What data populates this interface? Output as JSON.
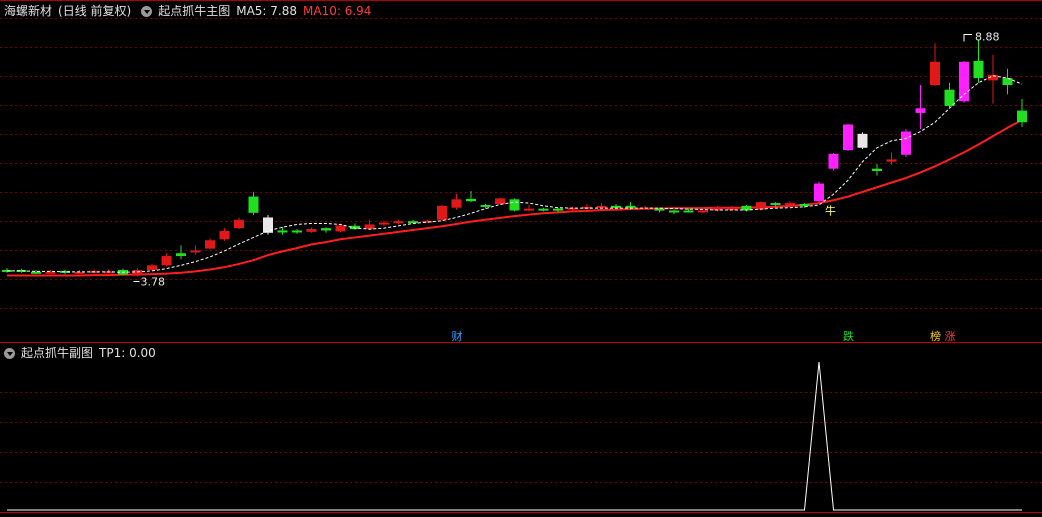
{
  "header_main": {
    "stock": "海螺新材",
    "period": "(日线 前复权)",
    "indicator": "起点抓牛主图",
    "ma5_label": "MA5: 7.88",
    "ma10_label": "MA10: 6.94"
  },
  "header_sub": {
    "indicator": "起点抓牛副图",
    "tp1_label": "TP1: 0.00"
  },
  "colors": {
    "up": "#e01818",
    "down": "#20e020",
    "signal": "#ff20ff",
    "neutral": "#e8e8e8",
    "ma10": "#ff1e1e",
    "ma5": "#ffffff",
    "grid": "#7a0000"
  },
  "chart_data": [
    {
      "type": "candlestick",
      "price_range": [
        2.8,
        9.3
      ],
      "grid": true,
      "annotations": [
        {
          "text": "3.78",
          "index": 9,
          "value": 3.78,
          "kind": "low"
        },
        {
          "text": "8.88",
          "index": 66,
          "value": 8.88,
          "kind": "high"
        },
        {
          "text": "牛",
          "index": 56,
          "value": 5.2,
          "kind": "label"
        }
      ],
      "event_tags": [
        {
          "text": "财",
          "index": 31,
          "color": "#3aa0ff"
        },
        {
          "text": "跌",
          "index": 58,
          "color": "#20e020"
        },
        {
          "text": "榜",
          "index": 64,
          "color": "#ffd000"
        },
        {
          "text": "涨",
          "index": 65,
          "color": "#ff3b3b"
        }
      ],
      "candles": [
        {
          "o": 3.9,
          "c": 3.92,
          "h": 3.96,
          "l": 3.86,
          "k": "g"
        },
        {
          "o": 3.92,
          "c": 3.89,
          "h": 3.95,
          "l": 3.86,
          "k": "g"
        },
        {
          "o": 3.88,
          "c": 3.87,
          "h": 3.92,
          "l": 3.84,
          "k": "g"
        },
        {
          "o": 3.87,
          "c": 3.88,
          "h": 3.92,
          "l": 3.85,
          "k": "r"
        },
        {
          "o": 3.9,
          "c": 3.86,
          "h": 3.92,
          "l": 3.83,
          "k": "g"
        },
        {
          "o": 3.86,
          "c": 3.88,
          "h": 3.92,
          "l": 3.84,
          "k": "r"
        },
        {
          "o": 3.87,
          "c": 3.9,
          "h": 3.93,
          "l": 3.85,
          "k": "r"
        },
        {
          "o": 3.88,
          "c": 3.89,
          "h": 3.93,
          "l": 3.86,
          "k": "r"
        },
        {
          "o": 3.92,
          "c": 3.82,
          "h": 3.95,
          "l": 3.8,
          "k": "g"
        },
        {
          "o": 3.82,
          "c": 3.92,
          "h": 3.96,
          "l": 3.78,
          "k": "r"
        },
        {
          "o": 3.92,
          "c": 4.02,
          "h": 4.05,
          "l": 3.9,
          "k": "r"
        },
        {
          "o": 4.02,
          "c": 4.22,
          "h": 4.28,
          "l": 4.0,
          "k": "r"
        },
        {
          "o": 4.22,
          "c": 4.28,
          "h": 4.45,
          "l": 4.15,
          "k": "g"
        },
        {
          "o": 4.3,
          "c": 4.34,
          "h": 4.45,
          "l": 4.25,
          "k": "r"
        },
        {
          "o": 4.38,
          "c": 4.56,
          "h": 4.6,
          "l": 4.36,
          "k": "r"
        },
        {
          "o": 4.58,
          "c": 4.76,
          "h": 4.82,
          "l": 4.55,
          "k": "r"
        },
        {
          "o": 4.82,
          "c": 5.0,
          "h": 5.05,
          "l": 4.8,
          "k": "r"
        },
        {
          "o": 5.15,
          "c": 5.5,
          "h": 5.6,
          "l": 5.1,
          "k": "g"
        },
        {
          "o": 5.05,
          "c": 4.72,
          "h": 5.1,
          "l": 4.68,
          "k": "w"
        },
        {
          "o": 4.77,
          "c": 4.75,
          "h": 4.85,
          "l": 4.68,
          "k": "g"
        },
        {
          "o": 4.77,
          "c": 4.74,
          "h": 4.8,
          "l": 4.7,
          "k": "g"
        },
        {
          "o": 4.74,
          "c": 4.8,
          "h": 4.83,
          "l": 4.72,
          "k": "r"
        },
        {
          "o": 4.82,
          "c": 4.77,
          "h": 4.84,
          "l": 4.72,
          "k": "g"
        },
        {
          "o": 4.75,
          "c": 4.88,
          "h": 4.9,
          "l": 4.73,
          "k": "r"
        },
        {
          "o": 4.8,
          "c": 4.87,
          "h": 4.92,
          "l": 4.78,
          "k": "g"
        },
        {
          "o": 4.8,
          "c": 4.9,
          "h": 5.0,
          "l": 4.78,
          "k": "r"
        },
        {
          "o": 4.9,
          "c": 4.94,
          "h": 4.98,
          "l": 4.86,
          "k": "r"
        },
        {
          "o": 4.94,
          "c": 4.97,
          "h": 5.0,
          "l": 4.9,
          "k": "r"
        },
        {
          "o": 4.96,
          "c": 4.97,
          "h": 5.0,
          "l": 4.93,
          "k": "g"
        },
        {
          "o": 4.96,
          "c": 4.98,
          "h": 5.0,
          "l": 4.94,
          "k": "r"
        },
        {
          "o": 5.0,
          "c": 5.3,
          "h": 5.32,
          "l": 4.98,
          "k": "r"
        },
        {
          "o": 5.26,
          "c": 5.44,
          "h": 5.56,
          "l": 5.22,
          "k": "r"
        },
        {
          "o": 5.45,
          "c": 5.4,
          "h": 5.62,
          "l": 5.38,
          "k": "g"
        },
        {
          "o": 5.32,
          "c": 5.28,
          "h": 5.34,
          "l": 5.24,
          "k": "g"
        },
        {
          "o": 5.34,
          "c": 5.46,
          "h": 5.48,
          "l": 5.32,
          "k": "r"
        },
        {
          "o": 5.44,
          "c": 5.2,
          "h": 5.46,
          "l": 5.18,
          "k": "g"
        },
        {
          "o": 5.22,
          "c": 5.24,
          "h": 5.32,
          "l": 5.18,
          "k": "r"
        },
        {
          "o": 5.24,
          "c": 5.22,
          "h": 5.26,
          "l": 5.18,
          "k": "g"
        },
        {
          "o": 5.24,
          "c": 5.2,
          "h": 5.26,
          "l": 5.16,
          "k": "g"
        },
        {
          "o": 5.22,
          "c": 5.26,
          "h": 5.28,
          "l": 5.18,
          "k": "r"
        },
        {
          "o": 5.24,
          "c": 5.28,
          "h": 5.34,
          "l": 5.22,
          "k": "r"
        },
        {
          "o": 5.28,
          "c": 5.3,
          "h": 5.36,
          "l": 5.24,
          "k": "r"
        },
        {
          "o": 5.3,
          "c": 5.28,
          "h": 5.34,
          "l": 5.24,
          "k": "g"
        },
        {
          "o": 5.3,
          "c": 5.26,
          "h": 5.38,
          "l": 5.22,
          "k": "g"
        },
        {
          "o": 5.26,
          "c": 5.25,
          "h": 5.3,
          "l": 5.22,
          "k": "r"
        },
        {
          "o": 5.24,
          "c": 5.2,
          "h": 5.26,
          "l": 5.16,
          "k": "g"
        },
        {
          "o": 5.2,
          "c": 5.16,
          "h": 5.22,
          "l": 5.12,
          "k": "g"
        },
        {
          "o": 5.18,
          "c": 5.2,
          "h": 5.24,
          "l": 5.16,
          "k": "g"
        },
        {
          "o": 5.18,
          "c": 5.2,
          "h": 5.22,
          "l": 5.14,
          "k": "r"
        },
        {
          "o": 5.2,
          "c": 5.28,
          "h": 5.3,
          "l": 5.18,
          "k": "r"
        },
        {
          "o": 5.25,
          "c": 5.24,
          "h": 5.3,
          "l": 5.2,
          "k": "r"
        },
        {
          "o": 5.3,
          "c": 5.2,
          "h": 5.32,
          "l": 5.18,
          "k": "g"
        },
        {
          "o": 5.22,
          "c": 5.38,
          "h": 5.4,
          "l": 5.2,
          "k": "r"
        },
        {
          "o": 5.36,
          "c": 5.32,
          "h": 5.38,
          "l": 5.28,
          "k": "g"
        },
        {
          "o": 5.32,
          "c": 5.36,
          "h": 5.4,
          "l": 5.3,
          "k": "r"
        },
        {
          "o": 5.34,
          "c": 5.32,
          "h": 5.36,
          "l": 5.26,
          "k": "g"
        },
        {
          "o": 5.4,
          "c": 5.78,
          "h": 5.82,
          "l": 5.38,
          "k": "m"
        },
        {
          "o": 6.1,
          "c": 6.42,
          "h": 6.44,
          "l": 6.06,
          "k": "m"
        },
        {
          "o": 6.5,
          "c": 7.05,
          "h": 7.06,
          "l": 6.48,
          "k": "m"
        },
        {
          "o": 6.55,
          "c": 6.85,
          "h": 6.88,
          "l": 6.52,
          "k": "w"
        },
        {
          "o": 6.05,
          "c": 6.1,
          "h": 6.2,
          "l": 5.95,
          "k": "g"
        },
        {
          "o": 6.25,
          "c": 6.3,
          "h": 6.45,
          "l": 6.18,
          "k": "r"
        },
        {
          "o": 6.4,
          "c": 6.9,
          "h": 6.95,
          "l": 6.35,
          "k": "m"
        },
        {
          "o": 7.3,
          "c": 7.4,
          "h": 7.9,
          "l": 6.95,
          "k": "m"
        },
        {
          "o": 7.9,
          "c": 8.4,
          "h": 8.8,
          "l": 7.88,
          "k": "r"
        },
        {
          "o": 7.8,
          "c": 7.45,
          "h": 7.95,
          "l": 7.4,
          "k": "g"
        },
        {
          "o": 8.4,
          "c": 7.55,
          "h": 8.42,
          "l": 7.52,
          "k": "m"
        },
        {
          "o": 8.05,
          "c": 8.42,
          "h": 8.88,
          "l": 7.95,
          "k": "g"
        },
        {
          "o": 8.0,
          "c": 8.12,
          "h": 8.55,
          "l": 7.5,
          "k": "r"
        },
        {
          "o": 8.05,
          "c": 7.9,
          "h": 8.25,
          "l": 7.7,
          "k": "g"
        },
        {
          "o": 7.35,
          "c": 7.1,
          "h": 7.6,
          "l": 7.0,
          "k": "g"
        }
      ],
      "ma5": [
        3.9,
        3.9,
        3.89,
        3.89,
        3.88,
        3.88,
        3.88,
        3.88,
        3.87,
        3.88,
        3.9,
        3.95,
        4.02,
        4.1,
        4.2,
        4.33,
        4.48,
        4.62,
        4.76,
        4.84,
        4.9,
        4.92,
        4.92,
        4.9,
        4.82,
        4.8,
        4.82,
        4.87,
        4.92,
        4.95,
        4.98,
        5.05,
        5.14,
        5.24,
        5.33,
        5.38,
        5.36,
        5.3,
        5.26,
        5.25,
        5.25,
        5.25,
        5.25,
        5.25,
        5.25,
        5.25,
        5.24,
        5.23,
        5.22,
        5.21,
        5.21,
        5.21,
        5.23,
        5.25,
        5.26,
        5.28,
        5.32,
        5.55,
        5.85,
        6.25,
        6.55,
        6.7,
        6.75,
        6.9,
        7.1,
        7.4,
        7.7,
        7.95,
        8.1,
        8.05,
        7.92
      ],
      "ma10": [
        3.8,
        3.8,
        3.8,
        3.8,
        3.8,
        3.8,
        3.81,
        3.81,
        3.82,
        3.82,
        3.83,
        3.84,
        3.86,
        3.89,
        3.93,
        3.98,
        4.05,
        4.13,
        4.24,
        4.32,
        4.39,
        4.47,
        4.52,
        4.58,
        4.62,
        4.66,
        4.7,
        4.74,
        4.78,
        4.82,
        4.86,
        4.91,
        4.96,
        5.0,
        5.04,
        5.08,
        5.11,
        5.14,
        5.16,
        5.18,
        5.19,
        5.21,
        5.22,
        5.23,
        5.24,
        5.24,
        5.25,
        5.25,
        5.25,
        5.26,
        5.26,
        5.26,
        5.27,
        5.28,
        5.3,
        5.32,
        5.36,
        5.42,
        5.5,
        5.6,
        5.7,
        5.8,
        5.9,
        6.02,
        6.15,
        6.3,
        6.45,
        6.62,
        6.8,
        6.98,
        7.15
      ]
    },
    {
      "type": "line",
      "name": "TP1",
      "value_range": [
        0,
        1
      ],
      "values": [
        0,
        0,
        0,
        0,
        0,
        0,
        0,
        0,
        0,
        0,
        0,
        0,
        0,
        0,
        0,
        0,
        0,
        0,
        0,
        0,
        0,
        0,
        0,
        0,
        0,
        0,
        0,
        0,
        0,
        0,
        0,
        0,
        0,
        0,
        0,
        0,
        0,
        0,
        0,
        0,
        0,
        0,
        0,
        0,
        0,
        0,
        0,
        0,
        0,
        0,
        0,
        0,
        0,
        0,
        0,
        0,
        1,
        0,
        0,
        0,
        0,
        0,
        0,
        0,
        0,
        0,
        0,
        0,
        0,
        0,
        0
      ]
    }
  ]
}
